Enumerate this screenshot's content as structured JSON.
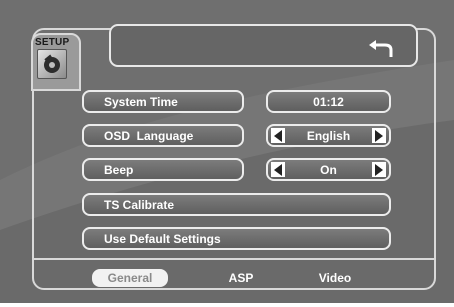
{
  "header": {
    "setup_label": "SETUP"
  },
  "menu": {
    "items": [
      {
        "label": "System Time"
      },
      {
        "label": "OSD  Language"
      },
      {
        "label": "Beep"
      },
      {
        "label": "TS Calibrate"
      },
      {
        "label": "Use Default Settings"
      }
    ],
    "values": {
      "system_time": "01:12",
      "osd_language": "English",
      "beep": "On"
    }
  },
  "tabs": [
    {
      "label": "General",
      "active": true
    },
    {
      "label": "ASP",
      "active": false
    },
    {
      "label": "Video",
      "active": false
    }
  ],
  "icons": {
    "back": "return-arrow-icon",
    "setup": "disc-settings-icon",
    "left": "arrow-left-icon",
    "right": "arrow-right-icon"
  },
  "colors": {
    "background": "#6f6f6f",
    "border": "#ececec",
    "active_tab": "#f2f2f2"
  }
}
